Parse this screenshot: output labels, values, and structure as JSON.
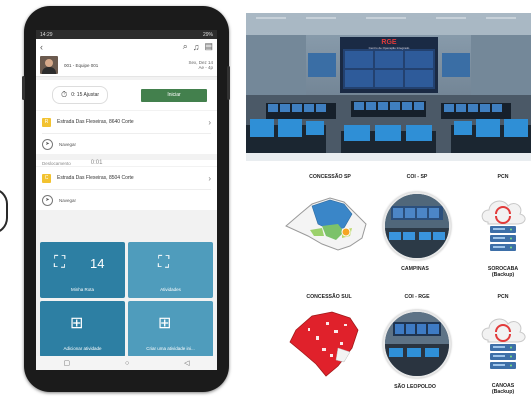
{
  "phone": {
    "status": {
      "left": "14:29",
      "right": "29%"
    },
    "user": {
      "team": "001 - Equipe 001",
      "date_line1": "Sex, Dez 14",
      "date_line2": "Ae - 4p"
    },
    "actions": {
      "pill_label": "0: 15 Ajustar",
      "start_label": "Iniciar"
    },
    "tasks": [
      {
        "badge": "R",
        "address": "Estrada Das Flexeiras, 8640 Corte",
        "nav_label": "Navegar",
        "color": "#f2c230"
      },
      {
        "badge": "C",
        "address": "Estrada Das Flexeiras, 8504 Corte",
        "nav_label": "Navegar",
        "color": "#f2c230"
      }
    ],
    "separator": {
      "label": "Deslocamento",
      "time": "0:01"
    },
    "tiles": [
      {
        "label": "Minha Rota",
        "count": "14",
        "icon": "map-pin-icon"
      },
      {
        "label": "Atividades",
        "count": "",
        "icon": "map-refresh-icon"
      },
      {
        "label": "Adicionar atividade",
        "count": "",
        "icon": "map-add-icon"
      },
      {
        "label": "Criar uma atividade ini...",
        "count": "",
        "icon": "map-add-icon"
      }
    ],
    "navbar": {
      "back": "◁",
      "home": "○",
      "recent": "▢"
    }
  },
  "photo": {
    "brand": "RGE",
    "subtitle": "Centro de Operação Integrado"
  },
  "diagram": {
    "row1": {
      "region": "CONCESSÃO SP",
      "coi": "COI - SP",
      "coi_site": "CAMPINAS",
      "pcn": "PCN",
      "pcn_site": "SOROCABA",
      "pcn_note": "(Backup)"
    },
    "row2": {
      "region": "CONCESSÃO SUL",
      "coi": "COI - RGE",
      "coi_site": "SÃO LEOPOLDO",
      "pcn": "PCN",
      "pcn_site": "CANOAS",
      "pcn_note": "(Backup)"
    }
  }
}
